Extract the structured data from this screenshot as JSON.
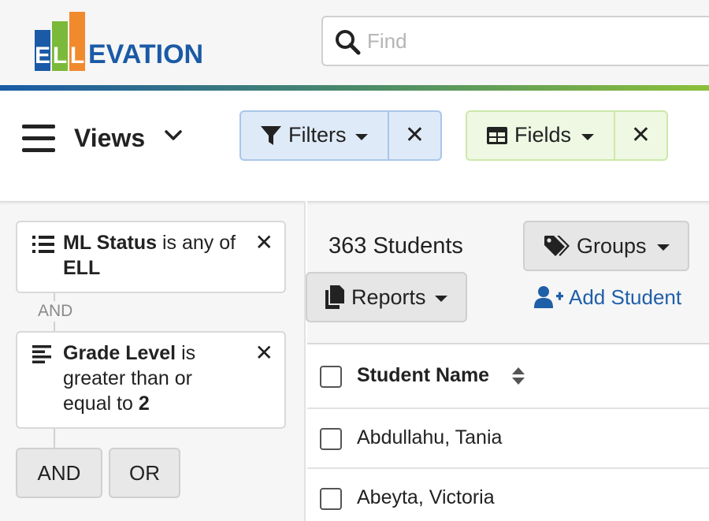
{
  "logo": {
    "letters": [
      "E",
      "L",
      "L"
    ],
    "rest": "EVATION"
  },
  "search": {
    "placeholder": "Find",
    "icon": "search-icon"
  },
  "toolbar": {
    "views_label": "Views",
    "filters_label": "Filters",
    "fields_label": "Fields"
  },
  "filters": {
    "conditions": [
      {
        "field": "ML Status",
        "op": "is any of",
        "value": "ELL",
        "icon": "list-icon"
      },
      {
        "field": "Grade Level",
        "op": "is greater than or equal to",
        "value": "2",
        "icon": "align-left-icon"
      }
    ],
    "joiner": "AND",
    "and_button": "AND",
    "or_button": "OR"
  },
  "main": {
    "count": "363 Students",
    "groups_label": "Groups",
    "reports_label": "Reports",
    "add_student_label": "Add Student"
  },
  "table": {
    "header": "Student Name",
    "rows": [
      "Abdullahu, Tania",
      "Abeyta, Victoria"
    ]
  },
  "colors": {
    "brand_blue": "#1a5aa6",
    "brand_green": "#7ab93a",
    "brand_orange": "#f1892d",
    "link": "#1f5fa8"
  }
}
